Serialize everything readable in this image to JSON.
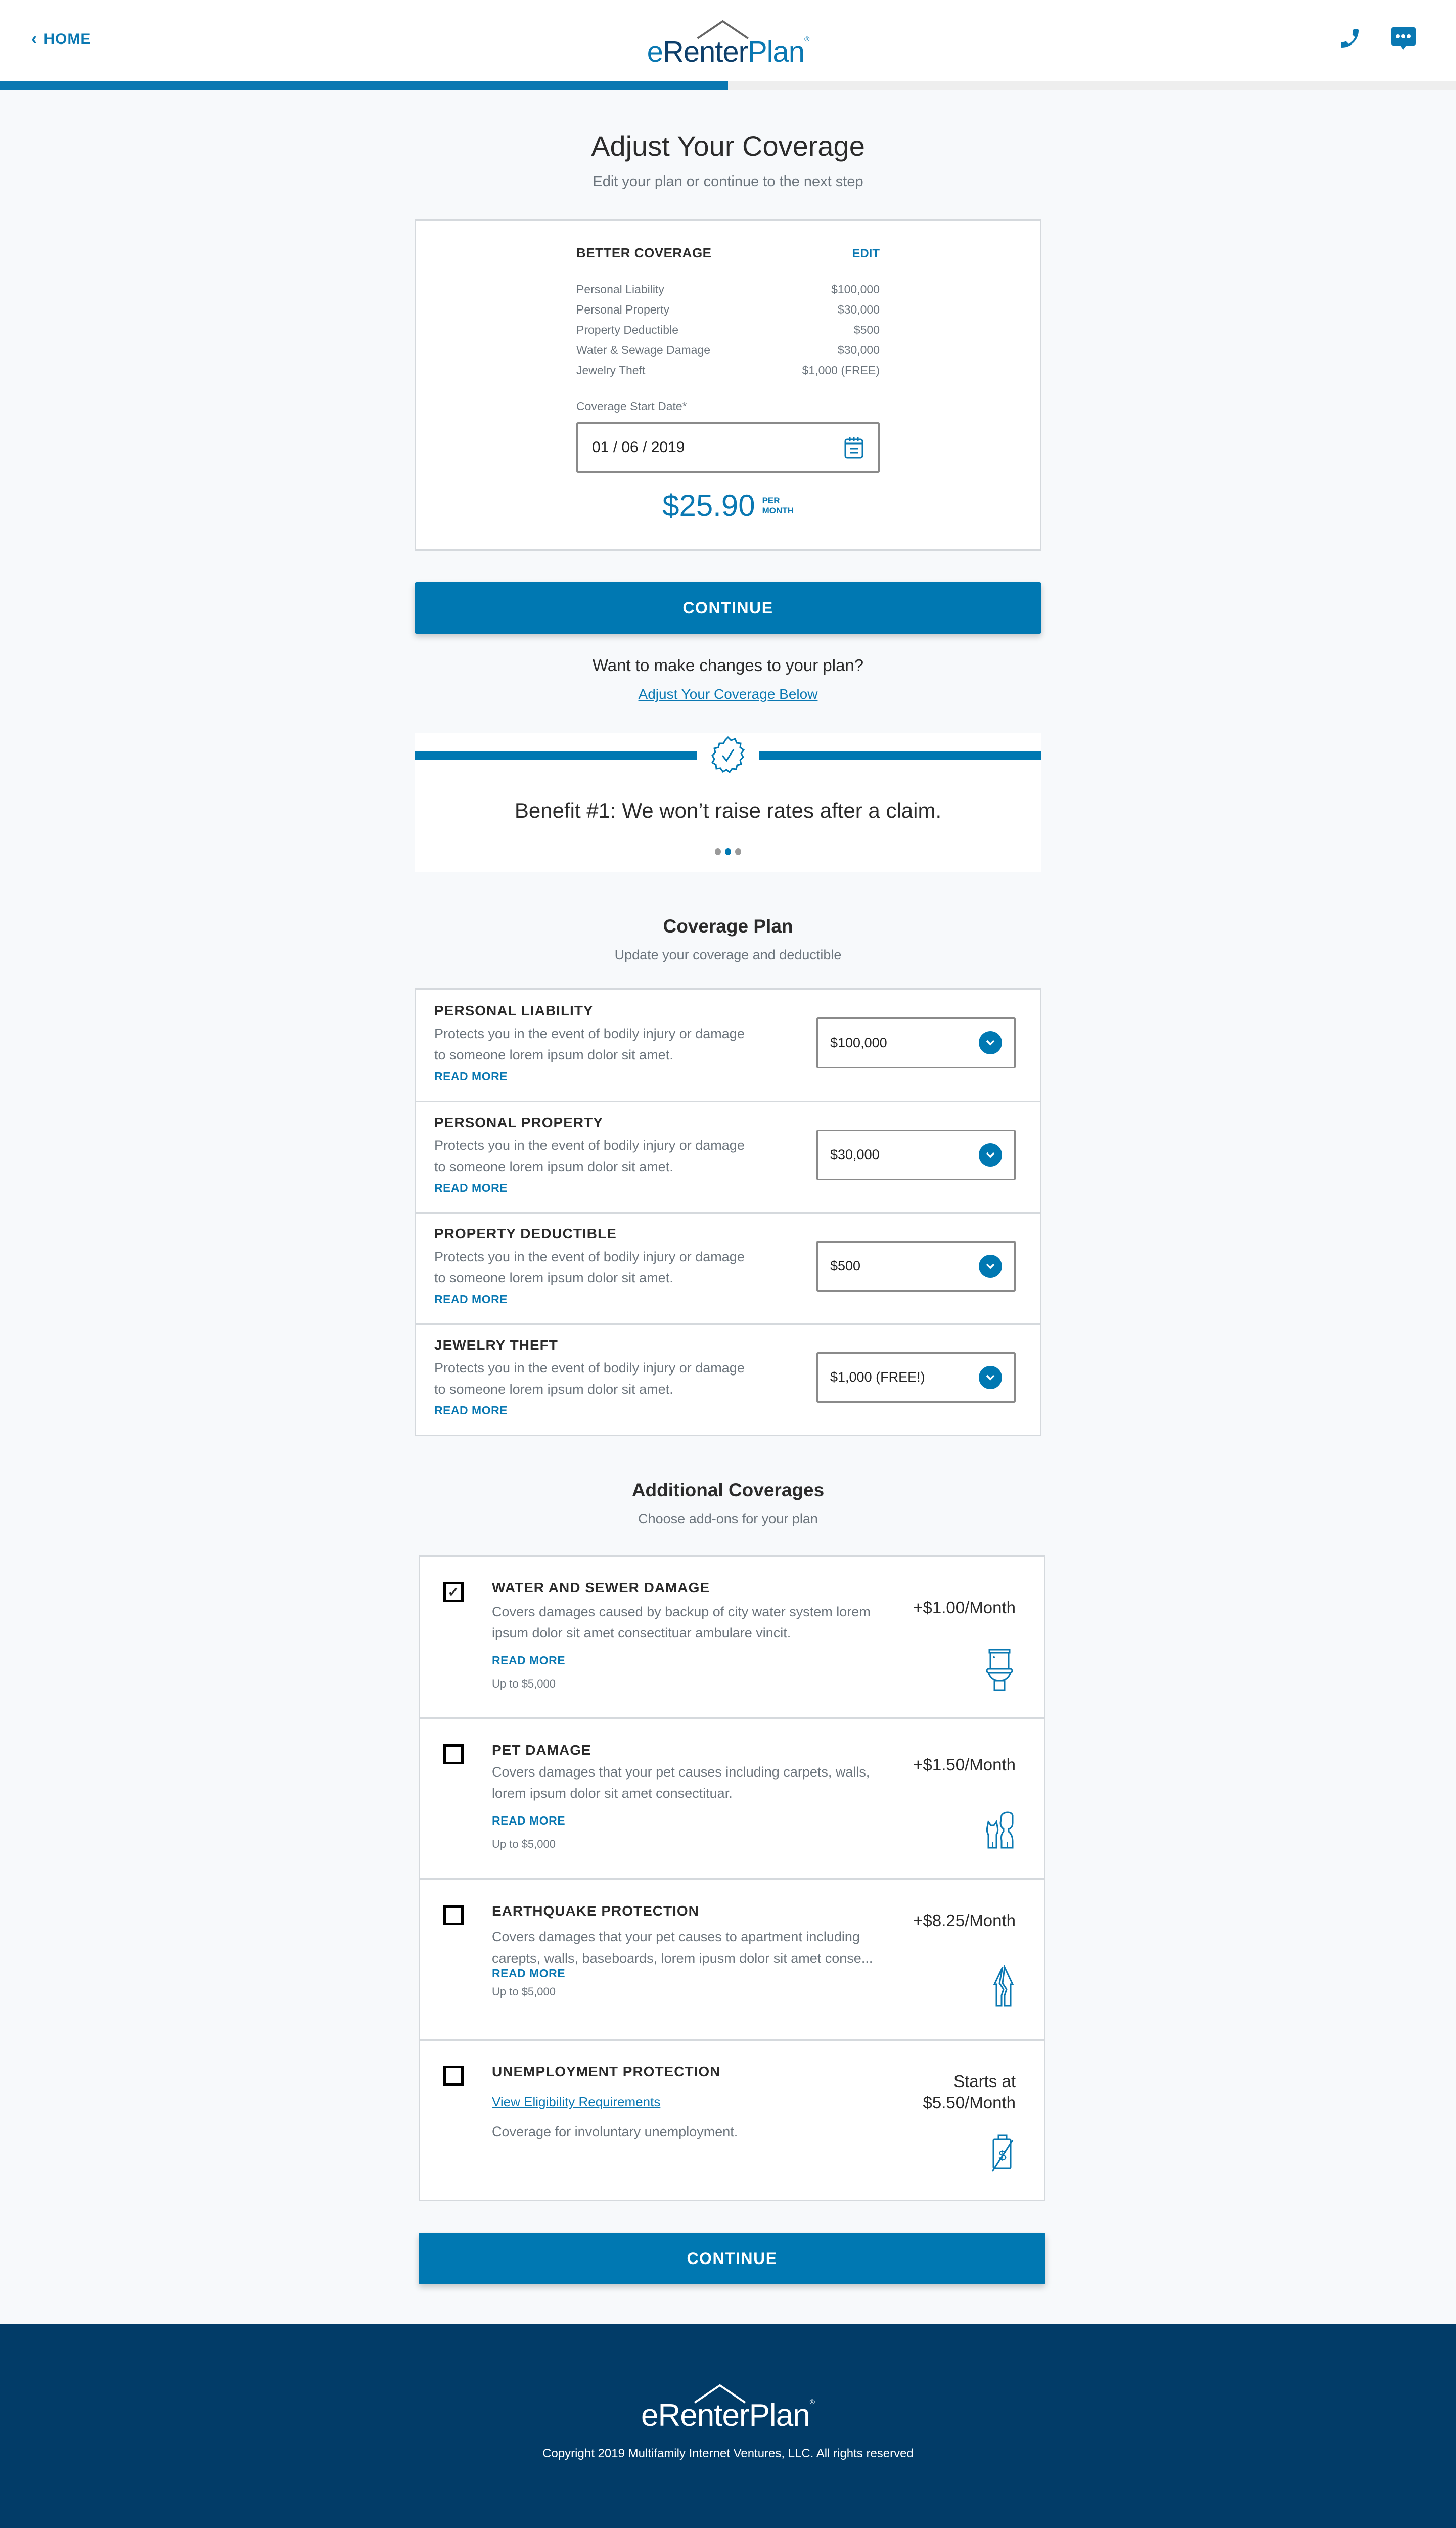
{
  "header": {
    "home_label": "HOME",
    "logo": {
      "e": "e",
      "renter": "Renter",
      "plan": "Plan",
      "reg": "®"
    },
    "icons": [
      "phone-icon",
      "chat-icon"
    ]
  },
  "progress": {
    "percent": 50
  },
  "colors": {
    "primary": "#0078b2",
    "footer": "#023c68",
    "muted": "#6c757d"
  },
  "hero": {
    "title": "Adjust Your Coverage",
    "subtitle": "Edit your plan or continue to the next step"
  },
  "summary": {
    "title": "BETTER COVERAGE",
    "edit_label": "EDIT",
    "rows": [
      {
        "label": "Personal Liability",
        "value": "$100,000"
      },
      {
        "label": "Personal Property",
        "value": "$30,000"
      },
      {
        "label": "Property Deductible",
        "value": "$500"
      },
      {
        "label": "Water & Sewage Damage",
        "value": "$30,000"
      },
      {
        "label": "Jewelry Theft",
        "value": "$1,000 (FREE)"
      }
    ],
    "date_label": "Coverage Start Date*",
    "date_value": "01 / 06 / 2019",
    "price": "$25.90",
    "per_1": "PER",
    "per_2": "MONTH"
  },
  "continue_label": "CONTINUE",
  "changes": {
    "question": "Want to make changes to your plan?",
    "link": "Adjust Your Coverage Below"
  },
  "benefit": {
    "text": "Benefit #1: We won’t raise rates after a claim.",
    "dots_total": 3,
    "dots_active": 2
  },
  "coverage_plan": {
    "title": "Coverage Plan",
    "subtitle": "Update your coverage and deductible",
    "items": [
      {
        "title": "PERSONAL LIABILITY",
        "desc_1": "Protects you in the event of bodily injury or damage",
        "desc_2": "to someone lorem ipsum dolor sit amet.",
        "read_more": "READ MORE",
        "value": "$100,000"
      },
      {
        "title": "PERSONAL PROPERTY",
        "desc_1": "Protects you in the event of bodily injury or damage",
        "desc_2": "to someone lorem ipsum dolor sit amet.",
        "read_more": "READ MORE",
        "value": "$30,000"
      },
      {
        "title": "PROPERTY DEDUCTIBLE",
        "desc_1": "Protects you in the event of bodily injury or damage",
        "desc_2": "to someone lorem ipsum dolor sit amet.",
        "read_more": "READ MORE",
        "value": "$500"
      },
      {
        "title": "JEWELRY THEFT",
        "desc_1": "Protects you in the event of bodily injury or damage",
        "desc_2": "to someone lorem ipsum dolor sit amet.",
        "read_more": "READ MORE",
        "value": "$1,000 (FREE!)"
      }
    ]
  },
  "additional": {
    "title": "Additional Coverages",
    "subtitle": "Choose add-ons for your plan",
    "items": [
      {
        "title": "WATER AND SEWER DAMAGE",
        "checked": true,
        "desc": "Covers damages caused by backup of city water system lorem ipsum dolor sit amet consectituar ambulare vincit.",
        "read_more": "READ MORE",
        "limit": "Up to $5,000",
        "price": "+$1.00/Month",
        "icon": "toilet-icon"
      },
      {
        "title": "PET DAMAGE",
        "checked": false,
        "desc": "Covers damages that your pet causes including carpets, walls, lorem ipsum dolor sit amet consectituar.",
        "read_more": "READ MORE",
        "limit": "Up to $5,000",
        "price": "+$1.50/Month",
        "icon": "pets-icon"
      },
      {
        "title": "EARTHQUAKE PROTECTION",
        "checked": false,
        "desc": "Covers  damages that your pet causes to apartment including carepts, walls, baseboards, lorem ipusm dolor sit amet conse...",
        "read_more": "READ MORE",
        "limit": "Up to $5,000",
        "price": "+$8.25/Month",
        "icon": "cracked-house-icon"
      },
      {
        "title": "UNEMPLOYMENT PROTECTION",
        "checked": false,
        "link": "View Eligibility Requirements",
        "desc": "Coverage for involuntary unemployment.",
        "price_1": "Starts at",
        "price_2": "$5.50/Month",
        "icon": "no-job-icon"
      }
    ]
  },
  "footer": {
    "logo": "eRenterPlan",
    "reg": "®",
    "copyright": "Copyright 2019 Multifamily Internet Ventures, LLC. All rights reserved"
  }
}
